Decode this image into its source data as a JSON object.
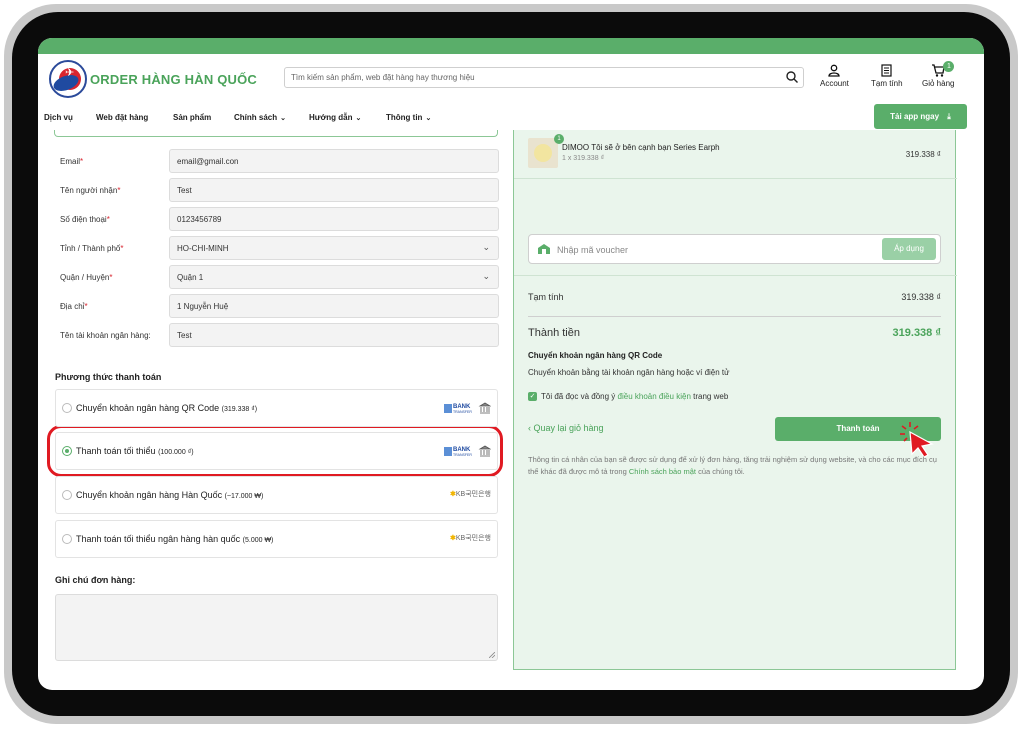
{
  "header": {
    "brand": "ORDER HÀNG HÀN QUỐC",
    "search_placeholder": "Tìm kiếm sản phẩm, web đặt hàng hay thương hiệu",
    "account_label": "Account",
    "subtotal_label": "Tạm tính",
    "cart_label": "Giỏ hàng",
    "cart_count": "1"
  },
  "nav": {
    "items": [
      "Dịch vụ",
      "Web đặt hàng",
      "Sản phẩm",
      "Chính sách",
      "Hướng dẫn",
      "Thông tin"
    ],
    "app_button": "Tải app ngay"
  },
  "form": {
    "fields": [
      {
        "label": "Email",
        "required": "*",
        "value": "email@gmail.con"
      },
      {
        "label": "Tên người nhận",
        "required": "*",
        "value": "Test"
      },
      {
        "label": "Số điện thoại",
        "required": "*",
        "value": "0123456789"
      },
      {
        "label": "Tỉnh / Thành phố",
        "required": "*",
        "value": "HO-CHI-MINH"
      },
      {
        "label": "Quận / Huyện",
        "required": "*",
        "value": "Quận 1"
      },
      {
        "label": "Địa chỉ",
        "required": "*",
        "value": "1 Nguyễn Huệ"
      },
      {
        "label": "Tên tài khoản ngân hàng:",
        "required": "",
        "value": "Test"
      }
    ]
  },
  "payment": {
    "title": "Phương thức thanh toán",
    "options": [
      {
        "label": "Chuyển khoản ngân hàng QR Code",
        "amount": "(319.338 ₫)",
        "logo": "BANK TRANSFER",
        "selected": false
      },
      {
        "label": "Thanh toán tối thiểu",
        "amount": "(100.000 ₫)",
        "logo": "BANK TRANSFER",
        "selected": true
      },
      {
        "label": "Chuyển khoản ngân hàng Hàn Quốc",
        "amount": "(~17.000 ₩)",
        "logo": "KB국민은행",
        "selected": false
      },
      {
        "label": "Thanh toán tối thiểu ngân hàng hàn quốc",
        "amount": "(5.000 ₩)",
        "logo": "KB국민은행",
        "selected": false
      }
    ],
    "bank_logo_text": "BANK",
    "bank_logo_sub": "TRANSFER",
    "kb_logo_mark": "KB",
    "kb_logo_text": "국민은행"
  },
  "notes": {
    "title": "Ghi chú đơn hàng:"
  },
  "summary": {
    "product_name": "DIMOO Tôi sẽ ở bên cạnh bạn Series Earph",
    "product_qty": "1 x 319.338 ₫",
    "product_price": "319.338 ₫",
    "product_badge": "1",
    "voucher_placeholder": "Nhập mã voucher",
    "apply_label": "Áp dụng",
    "subtotal_label": "Tạm tính",
    "subtotal_value": "319.338 ₫",
    "total_label": "Thành tiền",
    "total_value": "319.338 ₫",
    "method_title": "Chuyển khoản ngân hàng QR Code",
    "method_desc": "Chuyển khoản bằng tài khoản ngân hàng hoặc ví điện tử",
    "agree_prefix": "Tôi đã đọc và đồng ý",
    "agree_link": "điều khoản điều kiện",
    "agree_suffix": "trang web",
    "back_label": "Quay lại giỏ hàng",
    "pay_label": "Thanh toán",
    "privacy_text": "Thông tin cá nhân của bạn sẽ được sử dụng để xử lý đơn hàng, tăng trải nghiệm sử dụng website, và cho các mục đích cụ thể khác đã được mô tả trong",
    "privacy_link": "Chính sách bảo mật",
    "privacy_suffix": "của chúng tôi."
  },
  "colors": {
    "brand_green": "#5aae6a",
    "highlight_red": "#e01a22"
  }
}
